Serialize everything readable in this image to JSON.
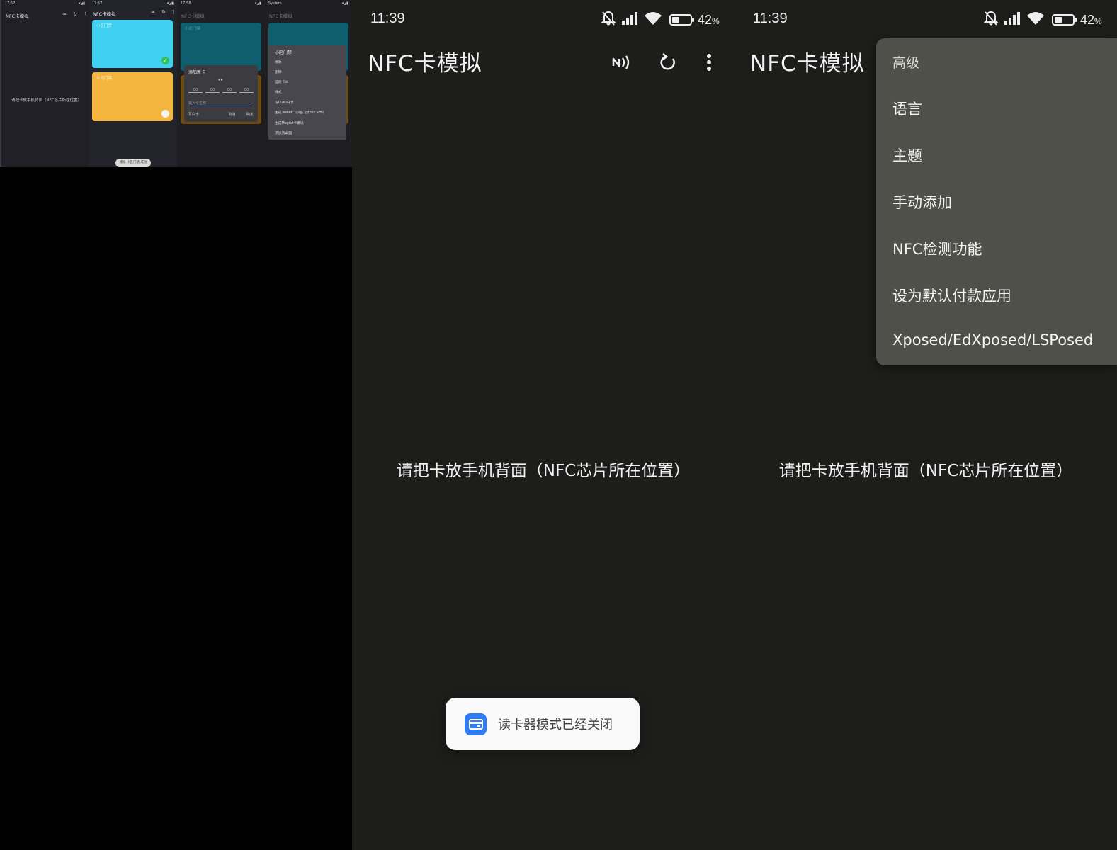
{
  "collage": {
    "status_time_1": "17:57",
    "status_time_2": "17:57",
    "status_time_3": "17:58",
    "status_time_4": "System",
    "app_title": "NFC卡模拟",
    "empty_hint": "请把卡放手机背面（NFC芯片所在位置）",
    "pill_text": "模拟 小区门禁 成功",
    "card_1_label": "小区门禁",
    "card_2_label": "公司门禁",
    "dialog": {
      "title": "添加新卡",
      "arrows": "◂ ▸",
      "hex_values": [
        "00",
        "00",
        "00",
        "00"
      ],
      "name_placeholder": "输入卡名称",
      "btn_left": "写白卡",
      "btn_mid": "取消",
      "btn_right": "确定"
    },
    "popup_menu": {
      "title": "小区门禁",
      "items": [
        "修改",
        "删除",
        "监听卡id",
        "样式",
        "写CUID白卡",
        "生成Tasker（小区门禁.tsk.xml）",
        "生成Magisk卡模块",
        "添加到桌面"
      ]
    }
  },
  "phone1": {
    "time": "11:39",
    "battery_percent": "42",
    "battery_unit": "%",
    "battery_level": 0.42,
    "title": "NFC卡模拟",
    "hint": "请把卡放手机背面（NFC芯片所在位置）",
    "toast": "读卡器模式已经关闭"
  },
  "phone2": {
    "time": "11:39",
    "battery_percent": "42",
    "battery_unit": "%",
    "battery_level": 0.42,
    "title": "NFC卡模拟",
    "hint": "请把卡放手机背面（NFC芯片所在位置）",
    "menu": {
      "header": "高级",
      "items": [
        "语言",
        "主题",
        "手动添加",
        "NFC检测功能",
        "设为默认付款应用",
        "Xposed/EdXposed/LSPosed"
      ]
    }
  },
  "colors": {
    "phone_bg": "#1d1d1b",
    "menu_bg": "#50504a",
    "card_cyan": "#3fd0ef",
    "card_amber": "#f5b640",
    "toast_icon": "#2f7df6"
  },
  "icons": {
    "toolbar": [
      "nfc-icon",
      "refresh-icon",
      "more-vert-icon"
    ],
    "status": [
      "bell-off-icon",
      "signal-icon",
      "wifi-icon",
      "battery-icon"
    ],
    "toast": "card-icon"
  }
}
